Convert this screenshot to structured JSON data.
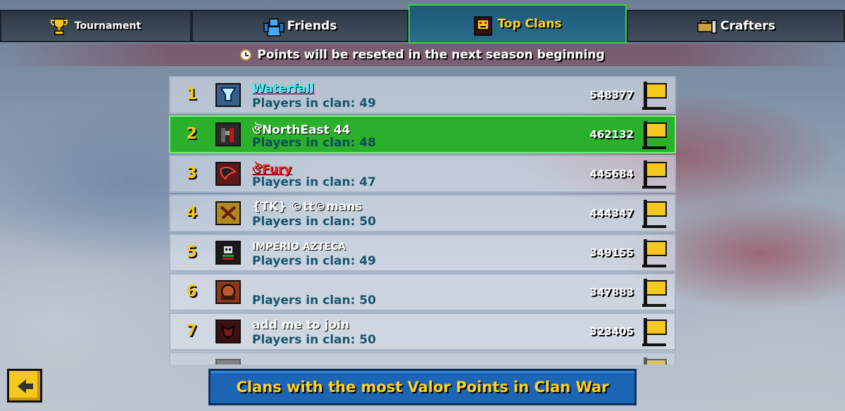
{
  "tabs": [
    {
      "label": "Tournament",
      "icon": "trophy-icon",
      "active": false
    },
    {
      "label": "Friends",
      "icon": "friends-icon",
      "active": false
    },
    {
      "label": "Top Clans",
      "icon": "clan-icon",
      "active": true
    },
    {
      "label": "Crafters",
      "icon": "crafters-icon",
      "active": false
    }
  ],
  "notice": {
    "text": "Points will be reseted in the next season beginning"
  },
  "clans": [
    {
      "rank": "1",
      "name": "Waterfall",
      "players": "Players in clan: 49",
      "points": "548377",
      "logo_color": "#3a5e8a",
      "name_color": "#3ff0ff"
    },
    {
      "rank": "2",
      "name": "ঔNorthEast 44",
      "players": "Players in clan: 48",
      "points": "462132",
      "logo_color": "#2a2a2a",
      "name_color": "#ffffff"
    },
    {
      "rank": "3",
      "name": "ঔFury",
      "players": "Players in clan: 47",
      "points": "445684",
      "logo_color": "#5a1a1a",
      "name_color": "#ff2020"
    },
    {
      "rank": "4",
      "name": "{TK} ©tt©mans",
      "players": "Players in clan: 50",
      "points": "444347",
      "logo_color": "#b08a20",
      "name_color": "#ffffff"
    },
    {
      "rank": "5",
      "name": "IMPERIO AZTECA",
      "players": "Players in clan: 49",
      "points": "349155",
      "logo_color": "#1a1a1a",
      "name_color": "#ffffff"
    },
    {
      "rank": "6",
      "name": "",
      "players": "Players in clan: 50",
      "points": "347883",
      "logo_color": "#8a3a1a",
      "name_color": "#ffffff"
    },
    {
      "rank": "7",
      "name": "add me to join",
      "players": "Players in clan: 50",
      "points": "323405",
      "logo_color": "#3a1010",
      "name_color": "#ffffff"
    }
  ],
  "footer": {
    "banner": "Clans with the most Valor Points in Clan War"
  }
}
